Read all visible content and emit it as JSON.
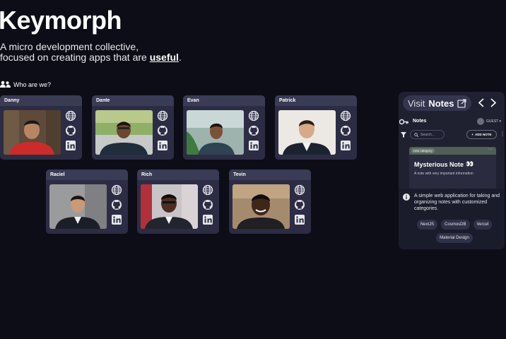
{
  "header": {
    "title": "Keymorph",
    "tagline_line1": "A micro development collective,",
    "tagline_line2_prefix": "focused on creating apps that are ",
    "tagline_emphasis": "useful",
    "tagline_suffix": "."
  },
  "team_heading": "Who are we?",
  "members": [
    {
      "name": "Danny"
    },
    {
      "name": "Dante"
    },
    {
      "name": "Evan"
    },
    {
      "name": "Patrick"
    },
    {
      "name": "Raciel"
    },
    {
      "name": "Rich"
    },
    {
      "name": "Tevin"
    }
  ],
  "preview": {
    "visit_prefix": "Visit",
    "visit_app": "Notes",
    "app_name": "Notes",
    "user_label": "GUEST",
    "search_placeholder": "Search...",
    "add_note_label": "ADD NOTE",
    "note": {
      "category": "new category",
      "title": "Mysterious Note",
      "emoji": "👀",
      "text": "A note with very important information"
    },
    "description": "A simple web application for taking and organizing notes with customized categories.",
    "tags": [
      "NextJS",
      "CosmosDB",
      "Vercel",
      "Material Design"
    ]
  },
  "icons": {
    "team": "users-icon",
    "website": "globe-icon",
    "github": "github-icon",
    "linkedin": "linkedin-icon",
    "external": "external-link-icon",
    "prev": "chevron-left-icon",
    "next": "chevron-right-icon",
    "app_logo": "key-icon",
    "filter": "filter-icon",
    "search": "search-icon",
    "info": "info-icon"
  },
  "colors": {
    "background": "#0d0d17",
    "card": "#2c2d44",
    "card_header": "#3a3b55",
    "panel": "#1f2030"
  }
}
